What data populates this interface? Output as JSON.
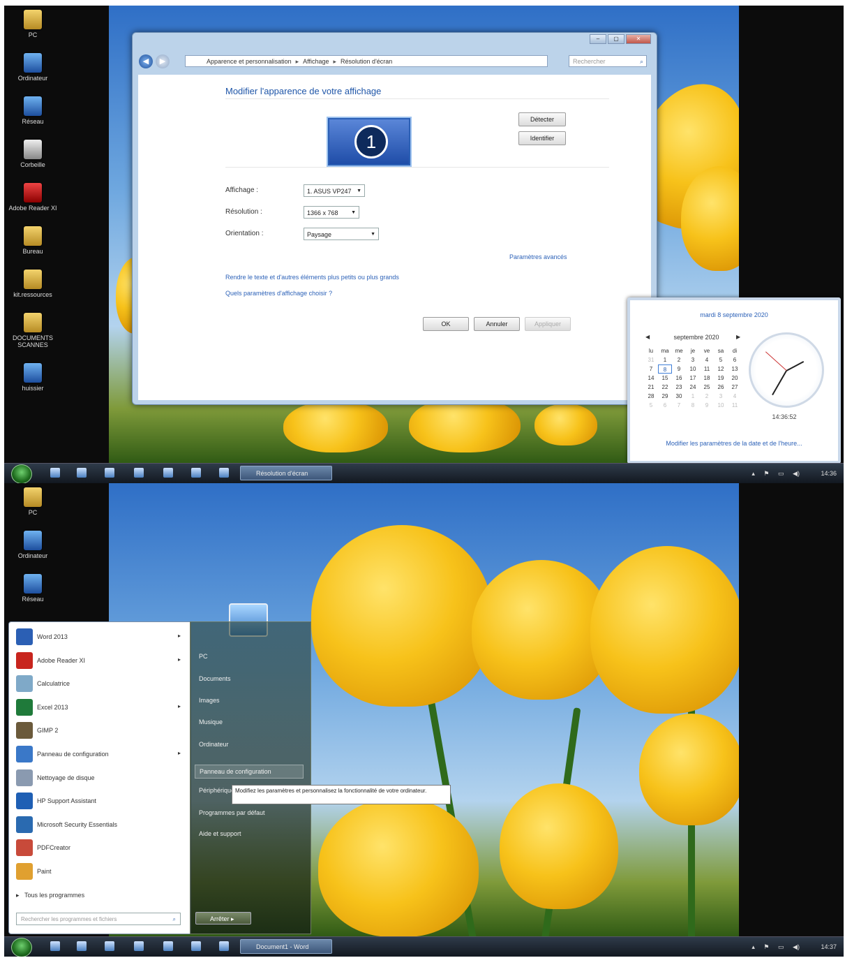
{
  "screen1": {
    "desktop_icons": [
      "PC",
      "Ordinateur",
      "Réseau",
      "Corbeille",
      "Adobe Reader XI",
      "Bureau",
      "kit.ressources",
      "DOCUMENTS SCANNES",
      "huissier"
    ],
    "window": {
      "breadcrumb": [
        "Apparence et personnalisation",
        "Affichage",
        "Résolution d'écran"
      ],
      "search_placeholder": "Rechercher",
      "title": "Modifier l'apparence de votre affichage",
      "monitor_number": "1",
      "detect_button": "Détecter",
      "identify_button": "Identifier",
      "display_label": "Affichage :",
      "display_value": "1. ASUS VP247",
      "resolution_label": "Résolution :",
      "resolution_value": "1366 x 768",
      "orientation_label": "Orientation :",
      "orientation_value": "Paysage",
      "advanced_link": "Paramètres avancés",
      "text_size_link": "Rendre le texte et d'autres éléments plus petits ou plus grands",
      "which_settings_link": "Quels paramètres d'affichage choisir ?",
      "ok_button": "OK",
      "cancel_button": "Annuler",
      "apply_button": "Appliquer"
    },
    "calendar": {
      "full_date": "mardi 8 septembre 2020",
      "month_label": "septembre 2020",
      "weekdays": [
        "lu",
        "ma",
        "me",
        "je",
        "ve",
        "sa",
        "di"
      ],
      "weeks": [
        [
          "31",
          "1",
          "2",
          "3",
          "4",
          "5",
          "6"
        ],
        [
          "7",
          "8",
          "9",
          "10",
          "11",
          "12",
          "13"
        ],
        [
          "14",
          "15",
          "16",
          "17",
          "18",
          "19",
          "20"
        ],
        [
          "21",
          "22",
          "23",
          "24",
          "25",
          "26",
          "27"
        ],
        [
          "28",
          "29",
          "30",
          "1",
          "2",
          "3",
          "4"
        ],
        [
          "5",
          "6",
          "7",
          "8",
          "9",
          "10",
          "11"
        ]
      ],
      "today": "8",
      "time": "14:36:52",
      "change_link": "Modifier les paramètres de la date et de l'heure..."
    },
    "taskbar": {
      "active_task": "Résolution d'écran",
      "clock": "14:36"
    }
  },
  "screen2": {
    "desktop_icons": [
      "PC",
      "Ordinateur",
      "Réseau"
    ],
    "start_menu": {
      "programs": [
        {
          "label": "Word 2013",
          "has_arrow": true,
          "color": "#2b5fb4"
        },
        {
          "label": "Adobe Reader XI",
          "has_arrow": true,
          "color": "#c8251e"
        },
        {
          "label": "Calculatrice",
          "has_arrow": false,
          "color": "#7fa9c8"
        },
        {
          "label": "Excel 2013",
          "has_arrow": true,
          "color": "#1f7a3a"
        },
        {
          "label": "GIMP 2",
          "has_arrow": false,
          "color": "#6b5a3b"
        },
        {
          "label": "Panneau de configuration",
          "has_arrow": true,
          "color": "#3a78c8"
        },
        {
          "label": "Nettoyage de disque",
          "has_arrow": false,
          "color": "#8a9ab0"
        },
        {
          "label": "HP Support Assistant",
          "has_arrow": false,
          "color": "#1f5fb4"
        },
        {
          "label": "Microsoft Security Essentials",
          "has_arrow": false,
          "color": "#2a6ab0"
        },
        {
          "label": "PDFCreator",
          "has_arrow": false,
          "color": "#c84a3a"
        },
        {
          "label": "Paint",
          "has_arrow": false,
          "color": "#e0a030"
        }
      ],
      "all_programs": "Tous les programmes",
      "search_placeholder": "Rechercher les programmes et fichiers",
      "right_items": [
        "PC",
        "Documents",
        "Images",
        "Musique",
        "Ordinateur",
        "Panneau de configuration",
        "Périphériques",
        "Programmes par défaut",
        "Aide et support"
      ],
      "highlighted": "Panneau de configuration",
      "tooltip": "Modifiez les paramètres et personnalisez la fonctionnalité de votre ordinateur.",
      "shutdown_button": "Arrêter"
    },
    "taskbar": {
      "active_task": "Document1 - Word",
      "clock": "14:37"
    }
  }
}
